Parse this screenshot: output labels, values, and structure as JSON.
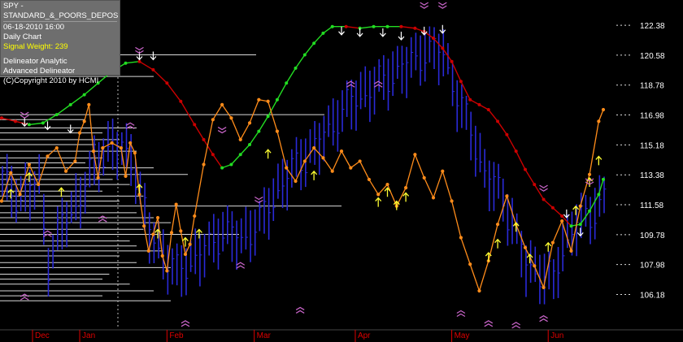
{
  "info_box": {
    "symbol": "SPY - STANDARD_&_POORS_DEPOS",
    "datetime": "06-18-2010  16:00",
    "period": "Daily Chart",
    "signal_weight": "Signal Weight: 239",
    "analytic": "Delineator Analytic",
    "advanced": "Advanced Delineator",
    "copyright": "(C)Copyright 2010 by HCMI"
  },
  "colors": {
    "background": "#000000",
    "price_bars": "#2a2ad8",
    "delineator_up": "#22dd22",
    "delineator_down": "#cc0000",
    "oscillator": "#ff8c1a",
    "buy_arrow": "#ffff33",
    "signal_arrow": "#ffffff",
    "month_labels": "#dd0000",
    "axis_labels": "#ffffff",
    "volume_profile": "#ffffff",
    "chevrons": "#cc66cc"
  },
  "chart_data": {
    "type": "line",
    "title": "SPY - STANDARD_&_POORS_DEPOS",
    "yticks": [
      122.38,
      120.58,
      118.78,
      116.98,
      115.18,
      113.38,
      111.58,
      109.78,
      107.98,
      106.18
    ],
    "ylim": [
      104.2,
      123.9
    ],
    "months": [
      {
        "label": "Dec",
        "x": 0
      },
      {
        "label": "Jan",
        "x": 17
      },
      {
        "label": "Feb",
        "x": 36
      },
      {
        "label": "Mar",
        "x": 55
      },
      {
        "label": "Apr",
        "x": 77
      },
      {
        "label": "May",
        "x": 98
      },
      {
        "label": "Jun",
        "x": 119
      }
    ],
    "x_count": 132,
    "price_bars": {
      "note": "daily high-low bars, x = trading-day index",
      "mid_points": [
        [
          0,
          113.0
        ],
        [
          4,
          112.0
        ],
        [
          8,
          113.0
        ],
        [
          10,
          108.0
        ],
        [
          13,
          110.5
        ],
        [
          17,
          112.0
        ],
        [
          20,
          114.0
        ],
        [
          24,
          115.2
        ],
        [
          28,
          114.5
        ],
        [
          32,
          110.0
        ],
        [
          35,
          108.5
        ],
        [
          38,
          107.5
        ],
        [
          40,
          108.0
        ],
        [
          44,
          108.8
        ],
        [
          48,
          110.0
        ],
        [
          52,
          109.5
        ],
        [
          56,
          110.5
        ],
        [
          60,
          112.5
        ],
        [
          64,
          114.0
        ],
        [
          68,
          115.0
        ],
        [
          72,
          116.5
        ],
        [
          76,
          117.8
        ],
        [
          80,
          118.5
        ],
        [
          84,
          119.3
        ],
        [
          88,
          120.0
        ],
        [
          92,
          120.8
        ],
        [
          96,
          120.8
        ],
        [
          99,
          118.0
        ],
        [
          102,
          116.0
        ],
        [
          105,
          113.5
        ],
        [
          108,
          112.5
        ],
        [
          111,
          110.5
        ],
        [
          114,
          108.0
        ],
        [
          117,
          107.5
        ],
        [
          120,
          107.0
        ],
        [
          122,
          109.0
        ],
        [
          125,
          110.5
        ],
        [
          128,
          111.0
        ],
        [
          131,
          112.0
        ]
      ],
      "half_range": 1.3
    },
    "series": [
      {
        "style": "dotted-line",
        "points": [
          [
            0,
            116.8
          ],
          [
            3,
            116.6
          ],
          [
            6,
            116.4
          ],
          [
            9,
            116.5
          ],
          [
            12,
            117.0
          ],
          [
            15,
            117.6
          ],
          [
            18,
            118.2
          ],
          [
            21,
            118.9
          ],
          [
            24,
            119.6
          ],
          [
            27,
            120.1
          ],
          [
            30,
            120.2
          ],
          [
            33,
            119.7
          ],
          [
            36,
            118.9
          ],
          [
            39,
            117.8
          ],
          [
            42,
            116.4
          ],
          [
            44,
            115.5
          ],
          [
            46,
            114.6
          ],
          [
            48,
            113.8
          ],
          [
            50,
            114.0
          ],
          [
            52,
            114.6
          ],
          [
            54,
            115.2
          ],
          [
            56,
            116.0
          ],
          [
            58,
            116.9
          ],
          [
            60,
            117.9
          ],
          [
            62,
            118.9
          ],
          [
            64,
            119.8
          ],
          [
            66,
            120.6
          ],
          [
            68,
            121.3
          ],
          [
            70,
            121.9
          ],
          [
            72,
            122.3
          ],
          [
            75,
            122.3
          ],
          [
            78,
            122.2
          ],
          [
            81,
            122.3
          ],
          [
            84,
            122.3
          ],
          [
            87,
            122.3
          ],
          [
            90,
            122.2
          ],
          [
            92,
            122.0
          ],
          [
            94,
            121.6
          ],
          [
            96,
            121.0
          ],
          [
            98,
            120.2
          ],
          [
            100,
            119.0
          ],
          [
            102,
            117.9
          ],
          [
            104,
            117.6
          ],
          [
            106,
            117.3
          ],
          [
            108,
            116.6
          ],
          [
            110,
            115.8
          ],
          [
            112,
            114.8
          ],
          [
            114,
            113.7
          ],
          [
            116,
            112.8
          ],
          [
            118,
            111.9
          ],
          [
            120,
            111.4
          ],
          [
            122,
            110.9
          ],
          [
            124,
            110.3
          ],
          [
            126,
            110.4
          ],
          [
            128,
            111.2
          ],
          [
            130,
            112.2
          ],
          [
            131,
            113.1
          ]
        ]
      },
      {
        "style": "dotted-line",
        "points": [
          [
            0,
            111.8
          ],
          [
            2,
            113.5
          ],
          [
            4,
            112.2
          ],
          [
            6,
            114.0
          ],
          [
            8,
            112.8
          ],
          [
            10,
            114.5
          ],
          [
            12,
            115.0
          ],
          [
            14,
            113.6
          ],
          [
            16,
            114.2
          ],
          [
            17,
            115.9
          ],
          [
            18,
            116.6
          ],
          [
            19,
            117.6
          ],
          [
            20,
            114.8
          ],
          [
            21,
            113.2
          ],
          [
            22,
            115.0
          ],
          [
            24,
            115.3
          ],
          [
            26,
            115.0
          ],
          [
            27,
            113.3
          ],
          [
            28,
            115.3
          ],
          [
            29,
            114.7
          ],
          [
            30,
            112.2
          ],
          [
            31,
            110.3
          ],
          [
            32,
            108.8
          ],
          [
            33,
            109.8
          ],
          [
            34,
            110.8
          ],
          [
            35,
            108.5
          ],
          [
            36,
            107.6
          ],
          [
            37,
            109.9
          ],
          [
            38,
            111.6
          ],
          [
            39,
            110.0
          ],
          [
            40,
            108.6
          ],
          [
            41,
            109.2
          ],
          [
            42,
            110.9
          ],
          [
            44,
            114.0
          ],
          [
            46,
            116.7
          ],
          [
            48,
            117.6
          ],
          [
            50,
            116.8
          ],
          [
            52,
            115.5
          ],
          [
            54,
            116.5
          ],
          [
            56,
            117.9
          ],
          [
            58,
            117.8
          ],
          [
            60,
            116.0
          ],
          [
            62,
            113.8
          ],
          [
            64,
            113.0
          ],
          [
            66,
            114.2
          ],
          [
            68,
            115.0
          ],
          [
            70,
            114.4
          ],
          [
            72,
            113.6
          ],
          [
            74,
            114.8
          ],
          [
            76,
            113.8
          ],
          [
            78,
            114.2
          ],
          [
            80,
            113.1
          ],
          [
            82,
            112.2
          ],
          [
            84,
            112.8
          ],
          [
            86,
            111.5
          ],
          [
            88,
            112.6
          ],
          [
            90,
            114.6
          ],
          [
            92,
            113.2
          ],
          [
            94,
            112.0
          ],
          [
            96,
            113.6
          ],
          [
            98,
            111.8
          ],
          [
            100,
            109.6
          ],
          [
            102,
            108.0
          ],
          [
            104,
            106.4
          ],
          [
            106,
            108.2
          ],
          [
            108,
            110.4
          ],
          [
            110,
            112.1
          ],
          [
            112,
            110.4
          ],
          [
            114,
            109.0
          ],
          [
            116,
            107.9
          ],
          [
            118,
            106.6
          ],
          [
            120,
            109.3
          ],
          [
            122,
            110.6
          ],
          [
            124,
            108.8
          ],
          [
            126,
            111.5
          ],
          [
            128,
            113.4
          ],
          [
            130,
            116.6
          ],
          [
            131,
            117.3
          ]
        ]
      }
    ],
    "volume_profile_levels": [
      {
        "price": 120.6,
        "length": 0.75
      },
      {
        "price": 119.3,
        "length": 0.45
      },
      {
        "price": 117.0,
        "length": 0.95
      },
      {
        "price": 116.7,
        "length": 0.25
      },
      {
        "price": 116.2,
        "length": 0.4
      },
      {
        "price": 115.9,
        "length": 0.3
      },
      {
        "price": 115.5,
        "length": 0.35
      },
      {
        "price": 115.2,
        "length": 0.28
      },
      {
        "price": 114.8,
        "length": 0.4
      },
      {
        "price": 114.4,
        "length": 0.3
      },
      {
        "price": 114.1,
        "length": 0.25
      },
      {
        "price": 113.8,
        "length": 0.45
      },
      {
        "price": 113.4,
        "length": 0.55
      },
      {
        "price": 113.1,
        "length": 0.33
      },
      {
        "price": 112.8,
        "length": 0.38
      },
      {
        "price": 112.4,
        "length": 0.3
      },
      {
        "price": 112.1,
        "length": 0.42
      },
      {
        "price": 111.8,
        "length": 0.35
      },
      {
        "price": 111.5,
        "length": 1.0
      },
      {
        "price": 111.1,
        "length": 0.4
      },
      {
        "price": 110.8,
        "length": 0.45
      },
      {
        "price": 110.5,
        "length": 0.5
      },
      {
        "price": 110.1,
        "length": 0.42
      },
      {
        "price": 109.8,
        "length": 0.7
      },
      {
        "price": 109.4,
        "length": 0.38
      },
      {
        "price": 109.1,
        "length": 0.4
      },
      {
        "price": 108.8,
        "length": 0.48
      },
      {
        "price": 108.5,
        "length": 0.35
      },
      {
        "price": 108.1,
        "length": 0.4
      },
      {
        "price": 107.8,
        "length": 0.5
      },
      {
        "price": 107.4,
        "length": 0.32
      },
      {
        "price": 107.1,
        "length": 0.3
      },
      {
        "price": 106.8,
        "length": 0.38
      },
      {
        "price": 106.4,
        "length": 0.45
      },
      {
        "price": 106.1,
        "length": 0.3
      },
      {
        "price": 105.8,
        "length": 0.5
      }
    ],
    "buy_arrows": [
      [
        2,
        112.2
      ],
      [
        6,
        113.2
      ],
      [
        13,
        112.3
      ],
      [
        30,
        112.5
      ],
      [
        34,
        109.8
      ],
      [
        40,
        109.3
      ],
      [
        43,
        109.8
      ],
      [
        58,
        114.6
      ],
      [
        68,
        113.3
      ],
      [
        82,
        111.7
      ],
      [
        84,
        112.3
      ],
      [
        86,
        111.5
      ],
      [
        88,
        112.0
      ],
      [
        106,
        108.4
      ],
      [
        108,
        109.2
      ],
      [
        112,
        110.2
      ],
      [
        115,
        108.3
      ],
      [
        119,
        109.0
      ],
      [
        125,
        111.2
      ],
      [
        128,
        112.9
      ],
      [
        130,
        114.2
      ]
    ],
    "signal_arrows": [
      [
        5,
        116.6
      ],
      [
        10,
        116.4
      ],
      [
        15,
        116.2
      ],
      [
        30,
        120.6
      ],
      [
        33,
        120.6
      ],
      [
        74,
        122.1
      ],
      [
        78,
        122.0
      ],
      [
        83,
        122.0
      ],
      [
        87,
        121.8
      ],
      [
        92,
        122.1
      ],
      [
        96,
        122.2
      ],
      [
        123,
        111.1
      ],
      [
        126,
        110.0
      ]
    ],
    "chevrons_top": [
      [
        5,
        117.0
      ],
      [
        30,
        120.9
      ],
      [
        48,
        116.1
      ],
      [
        56,
        111.9
      ],
      [
        92,
        123.6
      ],
      [
        96,
        123.6
      ],
      [
        118,
        112.6
      ],
      [
        128,
        113.0
      ]
    ],
    "chevrons_bottom": [
      [
        5,
        106.2
      ],
      [
        10,
        110.0
      ],
      [
        22,
        110.9
      ],
      [
        28,
        116.5
      ],
      [
        40,
        104.6
      ],
      [
        52,
        108.1
      ],
      [
        65,
        105.4
      ],
      [
        76,
        119.0
      ],
      [
        82,
        119.0
      ],
      [
        100,
        105.2
      ],
      [
        106,
        104.6
      ],
      [
        112,
        104.5
      ],
      [
        118,
        104.9
      ]
    ]
  }
}
